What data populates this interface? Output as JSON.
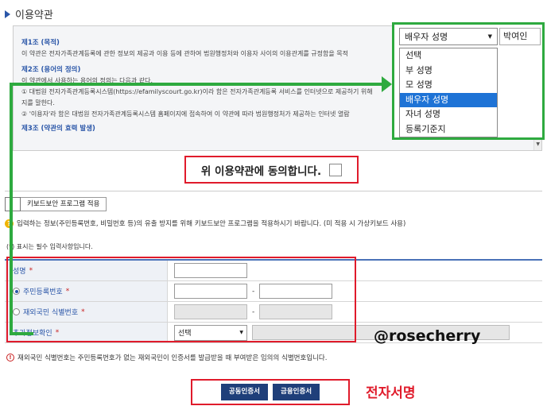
{
  "section": {
    "title": "이용약관"
  },
  "terms": {
    "article1_title": "제1조 (목적)",
    "article1_body": "이 약관은 전자가족관계등록에 관한 정보의 제공과 이용 등에 관하여 법원행정처와 이용자 사이의 이용관계를 규정함을 목적",
    "article2_title": "제2조 (용어의 정의)",
    "article2_intro": "이 약관에서 사용하는 용어의 정의는 다음과 같다.",
    "article2_item1a": "① 대법원 전자가족관계등록시스템(https://efamilyscourt.go.kr)이라 함은 전자가족관계등록 서비스를 인터넷으로 제공하기 위해",
    "article2_item1b": "지를 말한다.",
    "article2_item2": "② '이용자'라 함은 대법원 전자가족관계등록시스템 홈페이지에 접속하여 이 약관에 따라 법원행정처가 제공하는 인터넷 열람",
    "article3_title": "제3조 (약관의 효력 발생)"
  },
  "agree": {
    "label": "위 이용약관에 동의합니다."
  },
  "keyboard": {
    "toggle_label": "키보드보안 프로그램 적용",
    "notice": "입력하는 정보(주민등록번호, 비밀번호 등)의 유출 방지를 위해 키보드보안 프로그램을 적용하시기 바랍니다. (미 적용 시 가상키보드 사용)"
  },
  "required_note": {
    "prefix": "(",
    "star": "*",
    "text": ") 표시는 필수 입력사항입니다."
  },
  "form": {
    "name_label": "성명",
    "rrn_label": "주민등록번호",
    "foreign_label": "재외국민 식별번호",
    "extra_label": "추가정보확인",
    "dash": "-",
    "star": "*",
    "extra_select": "선택"
  },
  "watermark": "@rosecherry",
  "foreign_notice": "재외국민 식별번호는 주민등록번호가 없는 재외국민이 인증서를 발급받을 때 부여받은 임의의 식별번호입니다.",
  "buttons": {
    "public_cert": "공동인증서",
    "financial_cert": "금융인증서"
  },
  "esign_label": "전자서명",
  "dropdown": {
    "selected": "배우자 성명",
    "side_value": "박여인",
    "options": [
      "선택",
      "부 성명",
      "모 성명",
      "배우자 성명",
      "자녀 성명",
      "등록기준지"
    ],
    "selected_index": 3
  },
  "colors": {
    "annotation_red": "#e01b2b",
    "annotation_green": "#2eaa3f",
    "accent_blue": "#2a56a8",
    "select_highlight": "#1e73d6"
  }
}
